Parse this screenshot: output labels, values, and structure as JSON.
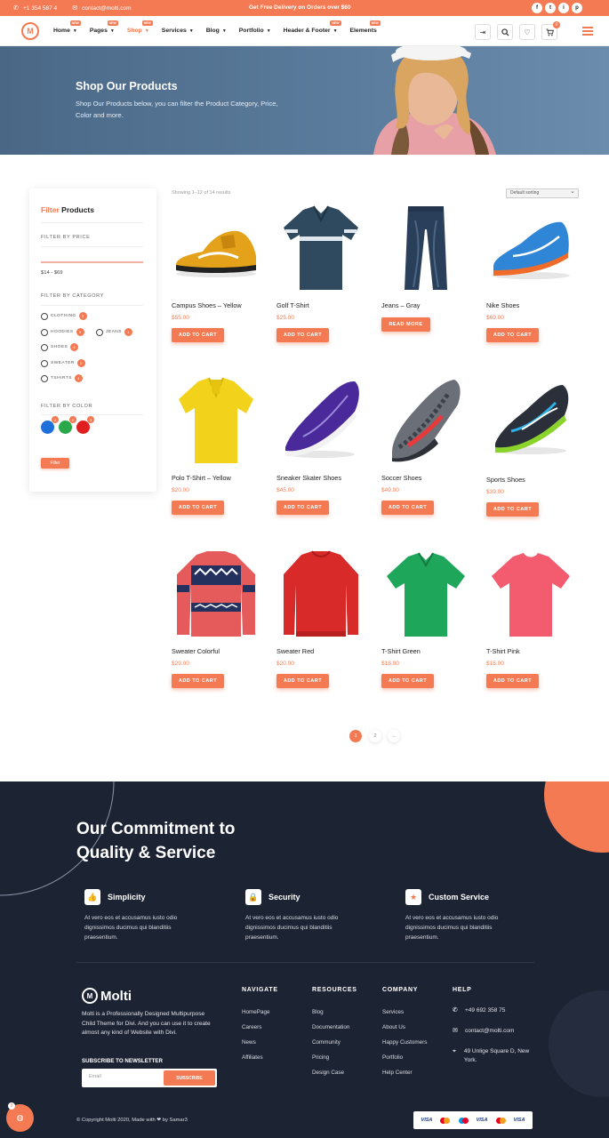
{
  "topbar": {
    "phone": "+1 354 587 4",
    "email": "contact@molti.com",
    "promo": "Get Free Delivery on Orders over $60",
    "socials": [
      "f",
      "t",
      "i",
      "p"
    ]
  },
  "nav": {
    "logo": "M",
    "items": [
      {
        "label": "Home",
        "badge": "NEW"
      },
      {
        "label": "Pages",
        "badge": "NEW"
      },
      {
        "label": "Shop",
        "badge": "NEW"
      },
      {
        "label": "Services",
        "badge": ""
      },
      {
        "label": "Blog",
        "badge": ""
      },
      {
        "label": "Portfolio",
        "badge": ""
      },
      {
        "label": "Header & Footer",
        "badge": "NEW"
      },
      {
        "label": "Elements",
        "badge": "NEW"
      }
    ],
    "cart_count": "0"
  },
  "hero": {
    "title": "Shop Our Products",
    "text": "Shop Our Products below, you can filter the Product Category, Price, Color and more."
  },
  "filter": {
    "title_accent": "Filter",
    "title_rest": "Products",
    "price_head": "FILTER BY PRICE",
    "price_range": "$14 - $69",
    "category_head": "FILTER BY CATEGORY",
    "categories": [
      {
        "label": "CLOTHING",
        "count": "3"
      },
      {
        "label": "HOODIES",
        "count": "3"
      },
      {
        "label": "JEANS",
        "count": "1"
      },
      {
        "label": "SHOES",
        "count": "4"
      },
      {
        "label": "SWEATER",
        "count": "2"
      },
      {
        "label": "TSHIRTS",
        "count": "4"
      }
    ],
    "color_head": "FILTER BY COLOR",
    "colors": [
      {
        "hex": "#1e6fd9",
        "count": "4"
      },
      {
        "hex": "#2aa84a",
        "count": "2"
      },
      {
        "hex": "#e02020",
        "count": "3"
      }
    ],
    "button": "Filter"
  },
  "shop": {
    "results": "Showing 1–12 of 14 results",
    "sort": "Default sorting",
    "products": [
      {
        "name": "Campus Shoes – Yellow",
        "price": "$55.00",
        "button": "ADD TO CART"
      },
      {
        "name": "Golf T-Shirt",
        "price": "$25.00",
        "button": "ADD TO CART"
      },
      {
        "name": "Jeans – Gray",
        "price": "",
        "button": "READ MORE"
      },
      {
        "name": "Nike Shoes",
        "price": "$69.00",
        "button": "ADD TO CART"
      },
      {
        "name": "Polo T-Shirt – Yellow",
        "price": "$20.00",
        "button": "ADD TO CART"
      },
      {
        "name": "Sneaker Skater Shoes",
        "price": "$45.00",
        "button": "ADD TO CART"
      },
      {
        "name": "Soccer Shoes",
        "price": "$49.00",
        "button": "ADD TO CART"
      },
      {
        "name": "Sports Shoes",
        "price": "$39.00",
        "button": "ADD TO CART"
      },
      {
        "name": "Sweater Colorful",
        "price": "$29.00",
        "button": "ADD TO CART"
      },
      {
        "name": "Sweater Red",
        "price": "$20.00",
        "button": "ADD TO CART"
      },
      {
        "name": "T-Shirt Green",
        "price": "$18.00",
        "button": "ADD TO CART"
      },
      {
        "name": "T-Shirt Pink",
        "price": "$15.00",
        "button": "ADD TO CART"
      }
    ],
    "pagination": [
      "1",
      "2",
      "→"
    ]
  },
  "commitment": {
    "title_line1": "Our Commitment to",
    "title_line2": "Quality & Service",
    "features": [
      {
        "title": "Simplicity",
        "text": "At vero eos et accusamus iusto odio dignissimos ducimus qui blanditiis praesentium.",
        "icon": "thumbs-up-icon"
      },
      {
        "title": "Security",
        "text": "At vero eos et accusamus iusto odio dignissimos ducimus qui blanditiis praesentium.",
        "icon": "lock-icon"
      },
      {
        "title": "Custom Service",
        "text": "At vero eos et accusamus iusto odio dignissimos ducimus qui blanditiis praesentium.",
        "icon": "star-icon"
      }
    ]
  },
  "footer": {
    "brand": "Molti",
    "about": "Molti is a Professionally Designed Multipurpose Child Theme for Divi. And you can use it to create almost any kind of Website with Divi.",
    "subscribe_title": "SUBSCRIBE TO NEWSLETTER",
    "subscribe_placeholder": "Email",
    "subscribe_button": "SUBSCRIBE",
    "columns": [
      {
        "head": "NAVIGATE",
        "links": [
          "HomePage",
          "Careers",
          "News",
          "Affiliates"
        ]
      },
      {
        "head": "RESOURCES",
        "links": [
          "Blog",
          "Documentation",
          "Community",
          "Pricing",
          "Design Case"
        ]
      },
      {
        "head": "COMPANY",
        "links": [
          "Services",
          "About Us",
          "Happy Customers",
          "Portfolio",
          "Help Center"
        ]
      }
    ],
    "help_head": "HELP",
    "phone": "+49 692 358 75",
    "email": "contact@molti.com",
    "address": "49 Unlige Square D, New York.",
    "copyright": "© Copyright Molti 2020, Made with ❤ by Samar3",
    "payments": [
      "VISA",
      "VISA",
      "VISA"
    ],
    "fab_count": "0"
  }
}
